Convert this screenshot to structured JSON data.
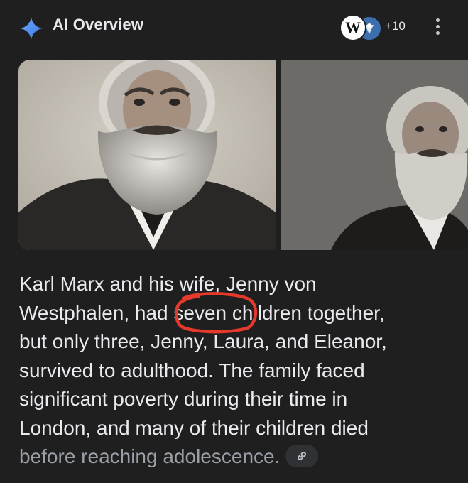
{
  "header": {
    "title": "AI Overview",
    "sources_count": "+10",
    "wiki_letter": "W",
    "spark_icon": "sparkle-icon",
    "more_icon": "more-vert-icon"
  },
  "images": [
    {
      "name": "marx-portrait-1"
    },
    {
      "name": "marx-portrait-2"
    }
  ],
  "overview": {
    "line1": "Karl Marx and his wife, Jenny von",
    "line2": "Westphalen, had seven children together,",
    "line3": "but only three, Jenny, Laura, and Eleanor,",
    "line4": "survived to adulthood. The family faced",
    "line5": "significant poverty during their time in",
    "line6": "London, and many of their children died",
    "line7": "before reaching adolescence."
  },
  "colors": {
    "background": "#1f1f1f",
    "text": "#e8eaed",
    "faded_text": "#9aa0a6",
    "annotation": "#e5392c",
    "spark": "#4e8ff8"
  }
}
